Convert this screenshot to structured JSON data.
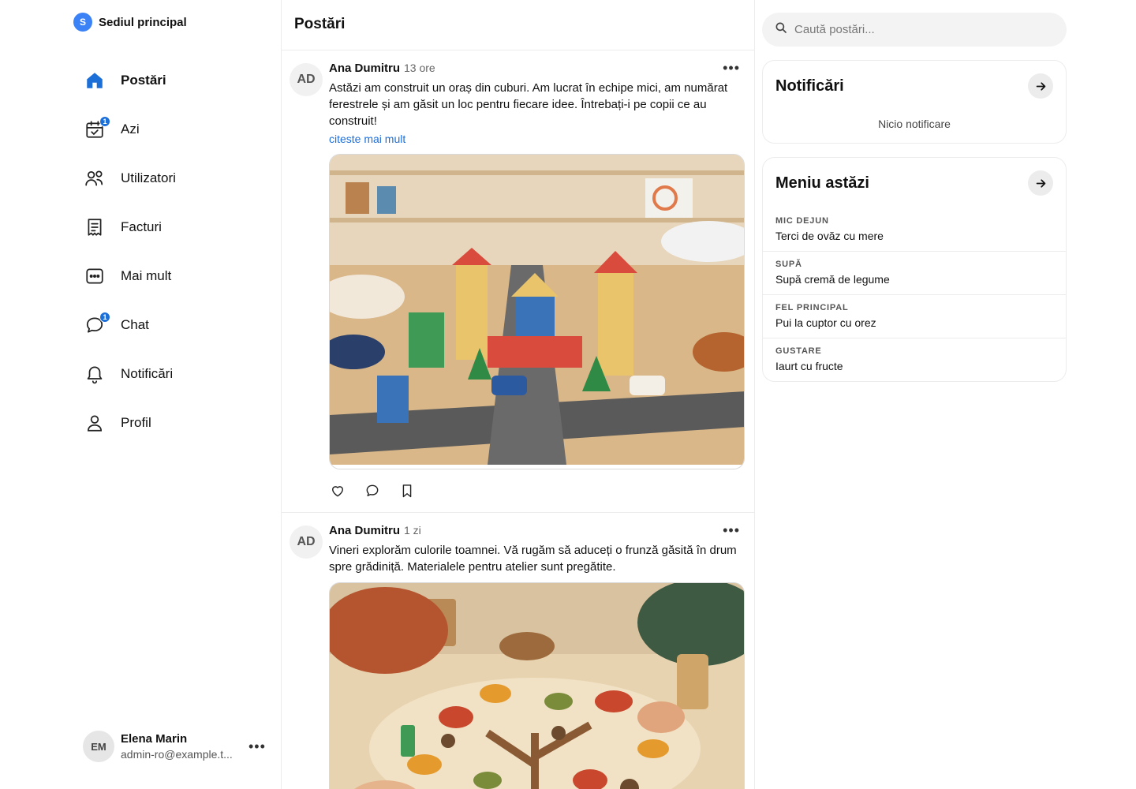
{
  "org": {
    "initial": "S",
    "name": "Sediul principal"
  },
  "nav": [
    {
      "label": "Postări",
      "icon": "home-icon",
      "active": true
    },
    {
      "label": "Azi",
      "icon": "calendar-check-icon",
      "badge": "1"
    },
    {
      "label": "Utilizatori",
      "icon": "users-icon"
    },
    {
      "label": "Facturi",
      "icon": "invoice-icon"
    },
    {
      "label": "Mai mult",
      "icon": "more-box-icon"
    },
    {
      "label": "Chat",
      "icon": "chat-icon",
      "badge": "1"
    },
    {
      "label": "Notificări",
      "icon": "bell-icon"
    },
    {
      "label": "Profil",
      "icon": "user-icon"
    }
  ],
  "user": {
    "initials": "EM",
    "name": "Elena Marin",
    "email": "admin-ro@example.t..."
  },
  "feed": {
    "title": "Postări",
    "posts": [
      {
        "initials": "AD",
        "author": "Ana Dumitru",
        "time": "13 ore",
        "text": "Astăzi am construit un oraș din cuburi. Am lucrat în echipe mici, am numărat ferestrele și am găsit un loc pentru fiecare idee. Întrebați-i pe copii ce au construit!",
        "read_more": "citeste mai mult",
        "image": "photo: children building a town from colorful wooden blocks"
      },
      {
        "initials": "AD",
        "author": "Ana Dumitru",
        "time": "1 zi",
        "text": "Vineri explorăm culorile toamnei. Vă rugăm să aduceți o frunză găsită în drum spre grădiniță. Materialele pentru atelier sunt pregătite.",
        "image": "photo: children making an autumn leaf collage"
      }
    ]
  },
  "search": {
    "placeholder": "Caută postări..."
  },
  "notifications": {
    "title": "Notificări",
    "empty": "Nicio notificare"
  },
  "menu": {
    "title": "Meniu astăzi",
    "items": [
      {
        "category": "MIC DEJUN",
        "dish": "Terci de ovăz cu mere"
      },
      {
        "category": "SUPĂ",
        "dish": "Supă cremă de legume"
      },
      {
        "category": "FEL PRINCIPAL",
        "dish": "Pui la cuptor cu orez"
      },
      {
        "category": "GUSTARE",
        "dish": "Iaurt cu fructe"
      }
    ]
  },
  "colors": {
    "accent": "#1d6fd8",
    "org_badge": "#3b82f6",
    "divider": "#ececec"
  }
}
